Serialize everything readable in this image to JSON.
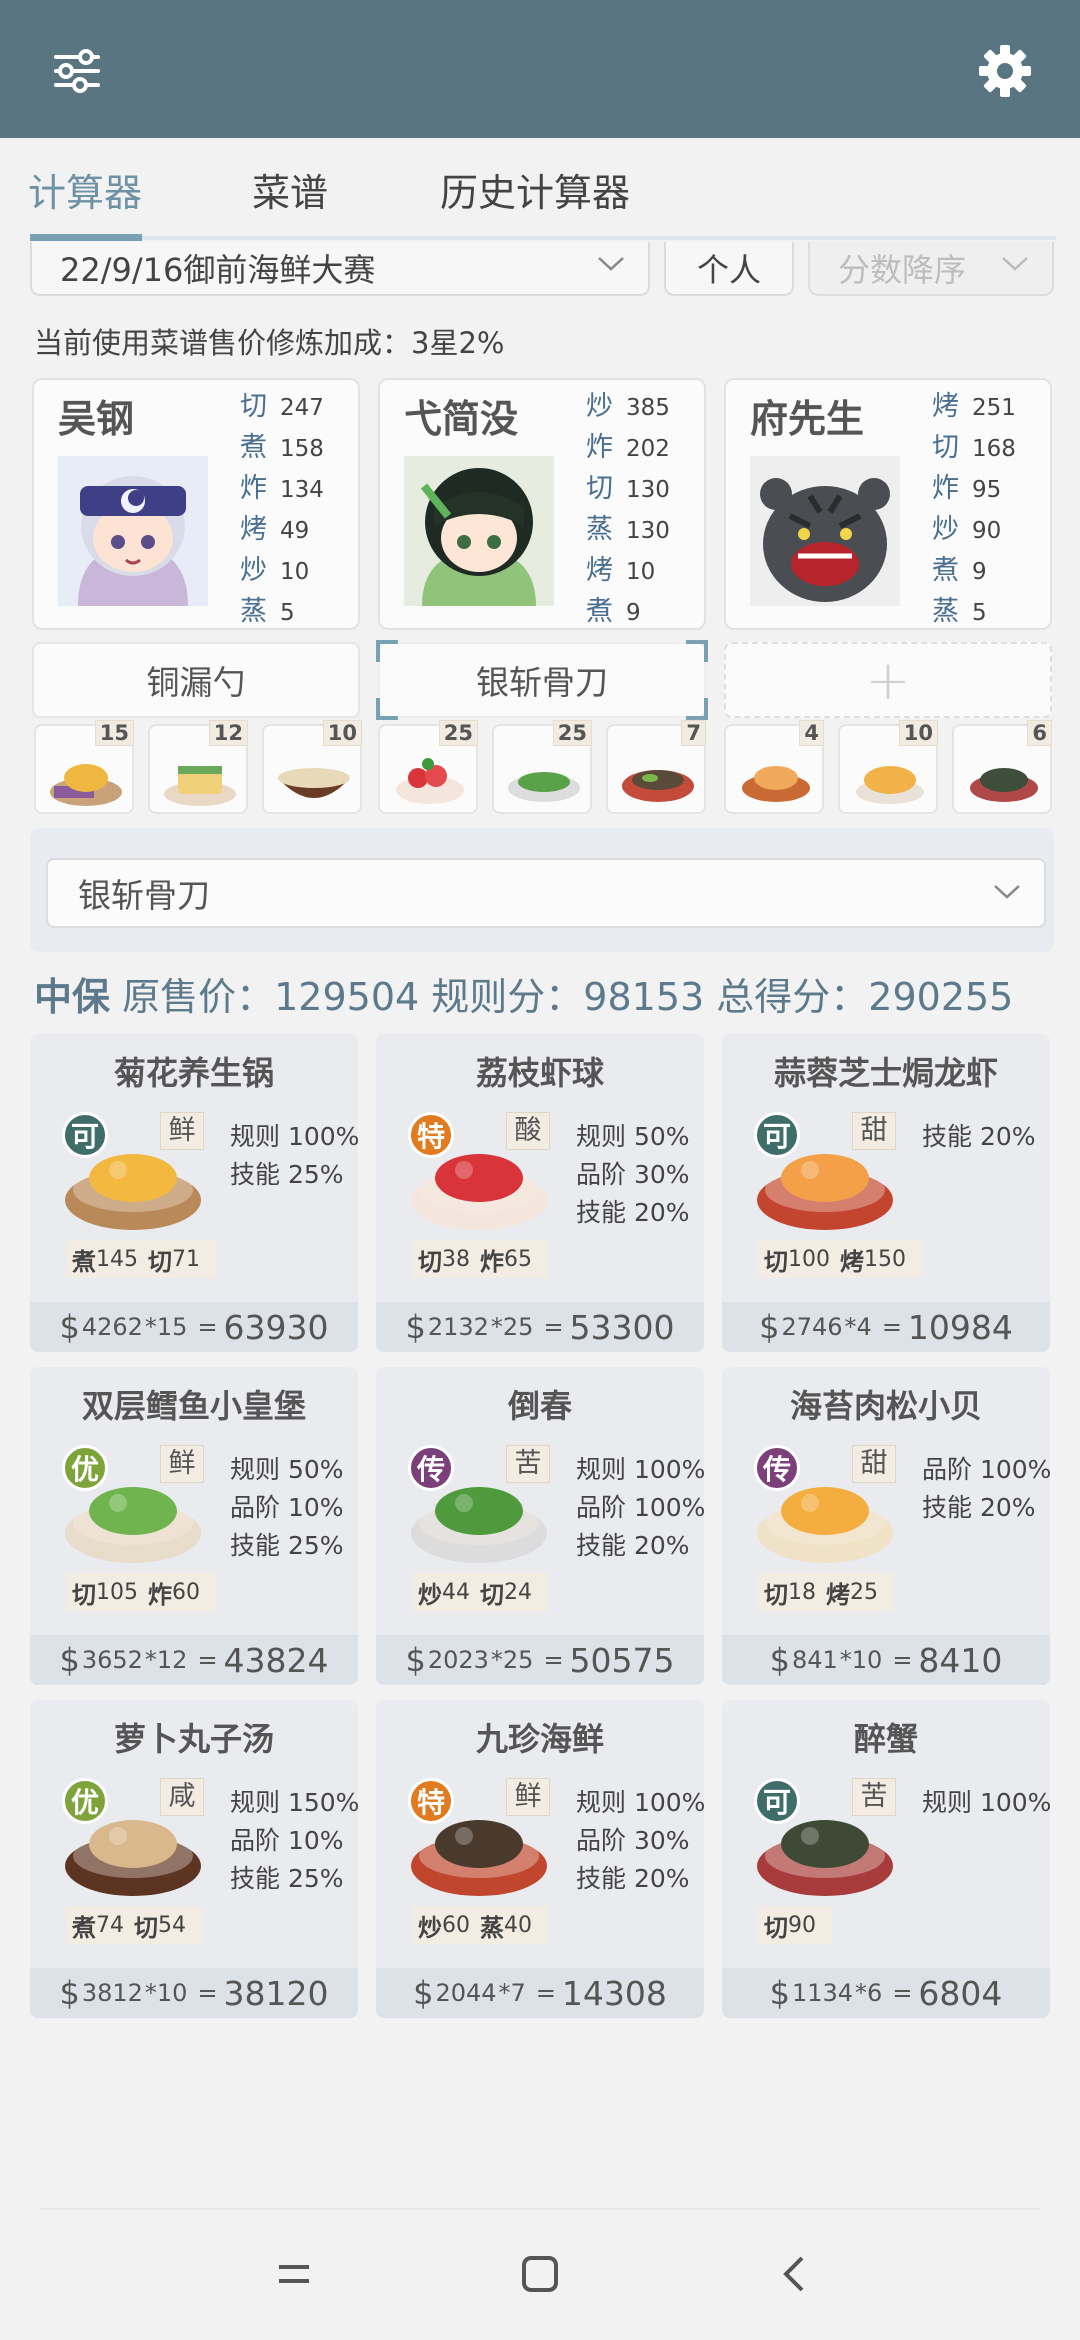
{
  "tabs": [
    "计算器",
    "菜谱",
    "历史计算器"
  ],
  "filters": {
    "event": "22/9/16御前海鲜大赛",
    "mode": "个人",
    "sort": "分数降序"
  },
  "bonus_text": "当前使用菜谱售价修炼加成：3星2%",
  "chefs": [
    {
      "name": "吴钢",
      "skills": [
        [
          "切",
          "247"
        ],
        [
          "煮",
          "158"
        ],
        [
          "炸",
          "134"
        ],
        [
          "烤",
          "49"
        ],
        [
          "炒",
          "10"
        ],
        [
          "蒸",
          "5"
        ]
      ]
    },
    {
      "name": "弋简没",
      "skills": [
        [
          "炒",
          "385"
        ],
        [
          "炸",
          "202"
        ],
        [
          "切",
          "130"
        ],
        [
          "蒸",
          "130"
        ],
        [
          "烤",
          "10"
        ],
        [
          "煮",
          "9"
        ]
      ]
    },
    {
      "name": "府先生",
      "skills": [
        [
          "烤",
          "251"
        ],
        [
          "切",
          "168"
        ],
        [
          "炸",
          "95"
        ],
        [
          "炒",
          "90"
        ],
        [
          "煮",
          "9"
        ],
        [
          "蒸",
          "5"
        ]
      ]
    }
  ],
  "equips": [
    "铜漏勺",
    "银斩骨刀",
    "+"
  ],
  "ingredients": [
    "15",
    "12",
    "10",
    "25",
    "25",
    "7",
    "4",
    "10",
    "6"
  ],
  "selected_equip": "银斩骨刀",
  "summary": {
    "grade": "中保",
    "l1": "原售价：",
    "v1": "129504",
    "l2": "规则分：",
    "v2": "98153",
    "l3": "总得分：",
    "v3": "290255"
  },
  "dishes": [
    {
      "name": "菊花养生锅",
      "badge": "可",
      "taste": "鲜",
      "rules": [
        "规则 100%",
        "技能 25%"
      ],
      "req": [
        [
          "煮",
          "145"
        ],
        [
          "切",
          "71"
        ]
      ],
      "price": "4262",
      "mult": "*15",
      "total": "63930"
    },
    {
      "name": "荔枝虾球",
      "badge": "特",
      "taste": "酸",
      "rules": [
        "规则 50%",
        "品阶 30%",
        "技能 20%"
      ],
      "req": [
        [
          "切",
          "38"
        ],
        [
          "炸",
          "65"
        ]
      ],
      "price": "2132",
      "mult": "*25",
      "total": "53300"
    },
    {
      "name": "蒜蓉芝士焗龙虾",
      "badge": "可",
      "taste": "甜",
      "rules": [
        "技能 20%"
      ],
      "req": [
        [
          "切",
          "100"
        ],
        [
          "烤",
          "150"
        ]
      ],
      "price": "2746",
      "mult": "*4",
      "total": "10984"
    },
    {
      "name": "双层鳕鱼小皇堡",
      "badge": "优",
      "taste": "鲜",
      "rules": [
        "规则 50%",
        "品阶 10%",
        "技能 25%"
      ],
      "req": [
        [
          "切",
          "105"
        ],
        [
          "炸",
          "60"
        ]
      ],
      "price": "3652",
      "mult": "*12",
      "total": "43824"
    },
    {
      "name": "倒春",
      "badge": "传",
      "taste": "苦",
      "rules": [
        "规则 100%",
        "品阶 100%",
        "技能 20%"
      ],
      "req": [
        [
          "炒",
          "44"
        ],
        [
          "切",
          "24"
        ]
      ],
      "price": "2023",
      "mult": "*25",
      "total": "50575"
    },
    {
      "name": "海苔肉松小贝",
      "badge": "传",
      "taste": "甜",
      "rules": [
        "品阶 100%",
        "技能 20%"
      ],
      "req": [
        [
          "切",
          "18"
        ],
        [
          "烤",
          "25"
        ]
      ],
      "price": "841",
      "mult": "*10",
      "total": "8410"
    },
    {
      "name": "萝卜丸子汤",
      "badge": "优",
      "taste": "咸",
      "rules": [
        "规则 150%",
        "品阶 10%",
        "技能 25%"
      ],
      "req": [
        [
          "煮",
          "74"
        ],
        [
          "切",
          "54"
        ]
      ],
      "price": "3812",
      "mult": "*10",
      "total": "38120"
    },
    {
      "name": "九珍海鲜",
      "badge": "特",
      "taste": "鲜",
      "rules": [
        "规则 100%",
        "品阶 30%",
        "技能 20%"
      ],
      "req": [
        [
          "炒",
          "60"
        ],
        [
          "蒸",
          "40"
        ]
      ],
      "price": "2044",
      "mult": "*7",
      "total": "14308"
    },
    {
      "name": "醉蟹",
      "badge": "可",
      "taste": "苦",
      "rules": [
        "规则 100%"
      ],
      "req": [
        [
          "切",
          "90"
        ]
      ],
      "price": "1134",
      "mult": "*6",
      "total": "6804"
    }
  ],
  "colors": {
    "header": "#5a7582",
    "accent": "#7aa0b4",
    "badge_ke": "#3f6e6a",
    "badge_te": "#e07b1f",
    "badge_you": "#7da33a",
    "badge_chuan": "#7b3f7a"
  }
}
